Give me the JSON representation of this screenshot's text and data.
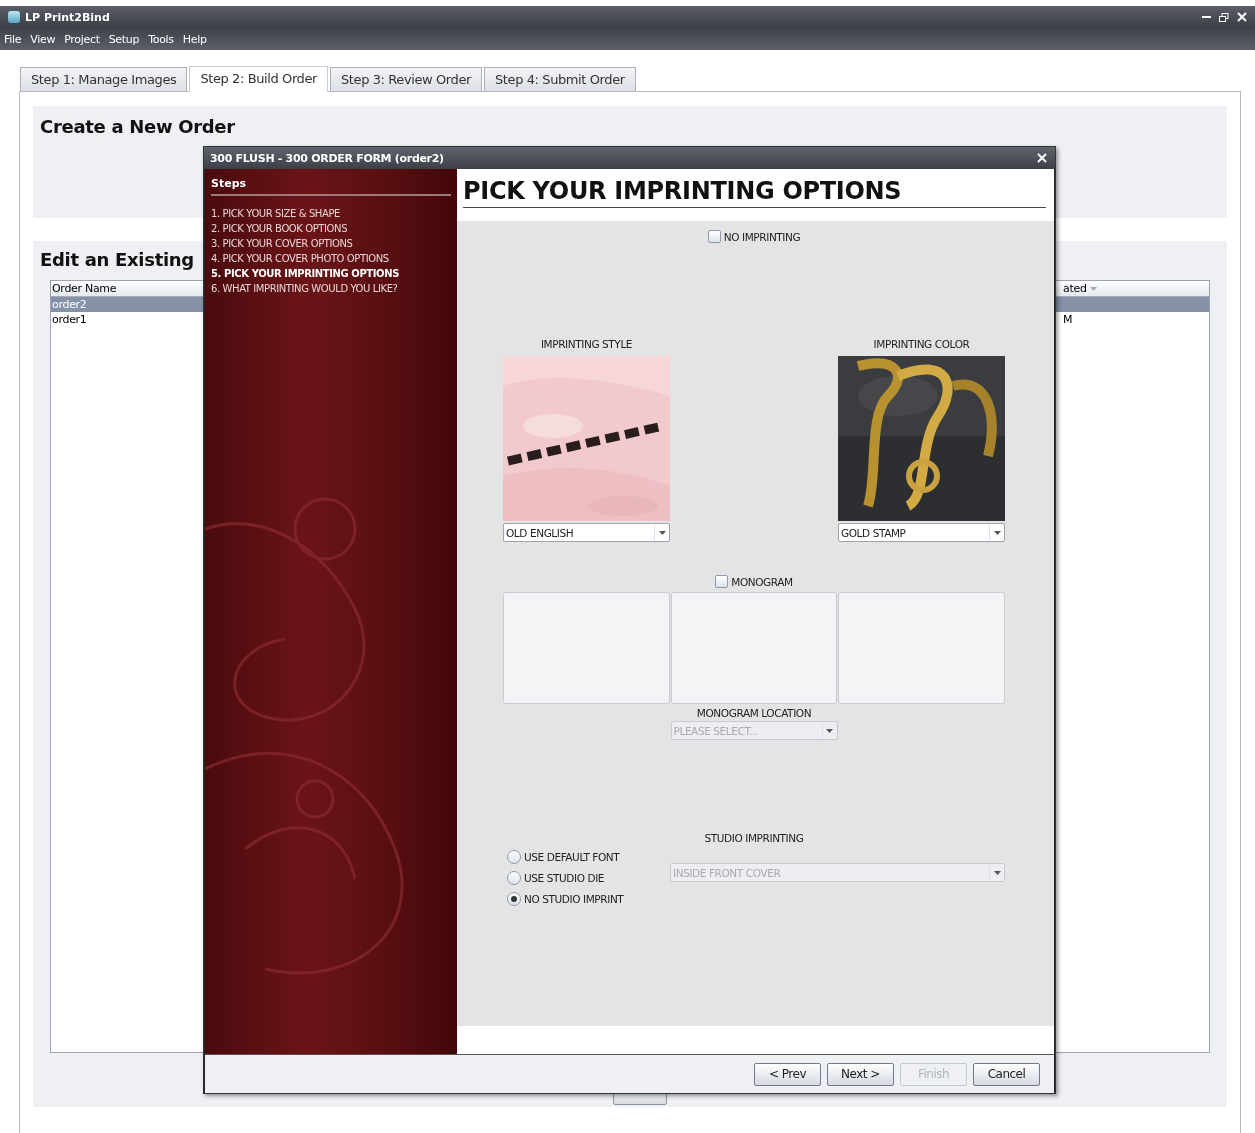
{
  "window": {
    "title": "LP Print2Bind"
  },
  "menu": [
    "File",
    "View",
    "Project",
    "Setup",
    "Tools",
    "Help"
  ],
  "tabs": [
    {
      "label": "Step 1: Manage Images",
      "selected": false
    },
    {
      "label": "Step 2: Build Order",
      "selected": true
    },
    {
      "label": "Step 3: Review Order",
      "selected": false
    },
    {
      "label": "Step 4: Submit Order",
      "selected": false
    }
  ],
  "create_section": {
    "title": "Create a New Order"
  },
  "edit_section": {
    "title": "Edit an Existing",
    "table": {
      "columns": [
        "Order Name",
        "ated"
      ],
      "rows": [
        {
          "name": "order2",
          "selected": true
        },
        {
          "name": "order1",
          "column_2": "M",
          "selected": false
        }
      ]
    }
  },
  "dialog": {
    "title": "300 FLUSH - 300 ORDER FORM (order2)",
    "steps_title": "Steps",
    "steps": [
      {
        "label": "1. PICK YOUR SIZE & SHAPE",
        "selected": false
      },
      {
        "label": "2. PICK YOUR BOOK OPTIONS",
        "selected": false
      },
      {
        "label": "3. PICK YOUR COVER OPTIONS",
        "selected": false
      },
      {
        "label": "4. PICK YOUR COVER PHOTO OPTIONS",
        "selected": false
      },
      {
        "label": "5. PICK YOUR IMPRINTING OPTIONS",
        "selected": true
      },
      {
        "label": "6. WHAT IMPRINTING WOULD YOU LIKE?",
        "selected": false
      }
    ],
    "heading": "PICK YOUR IMPRINTING OPTIONS",
    "no_imprinting": {
      "label": "NO IMPRINTING",
      "checked": false
    },
    "imprinting_style": {
      "label": "IMPRINTING STYLE",
      "value": "OLD ENGLISH"
    },
    "imprinting_color": {
      "label": "IMPRINTING COLOR",
      "value": "GOLD STAMP"
    },
    "monogram": {
      "label": "MONOGRAM",
      "checked": false
    },
    "monogram_location": {
      "label": "MONOGRAM LOCATION",
      "placeholder": "PLEASE SELECT...",
      "disabled": true
    },
    "studio_imprinting": {
      "label": "STUDIO IMPRINTING",
      "options": [
        {
          "label": "USE DEFAULT FONT",
          "selected": false
        },
        {
          "label": "USE STUDIO DIE",
          "selected": false
        },
        {
          "label": "NO STUDIO IMPRINT",
          "selected": true
        }
      ],
      "location": {
        "value": "INSIDE FRONT COVER",
        "disabled": true
      }
    },
    "buttons": [
      {
        "label": "< Prev",
        "disabled": false
      },
      {
        "label": "Next >",
        "disabled": false
      },
      {
        "label": "Finish",
        "disabled": true
      },
      {
        "label": "Cancel",
        "disabled": false
      }
    ]
  }
}
